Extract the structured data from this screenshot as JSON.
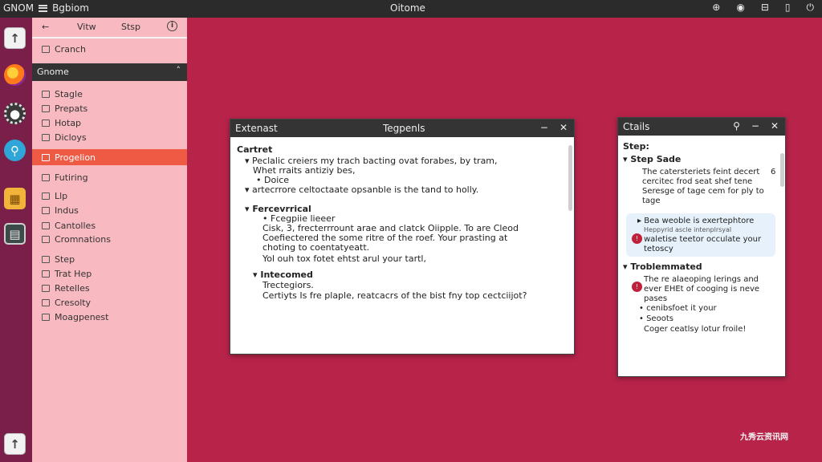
{
  "topbar": {
    "app_name": "GNOM",
    "menu": "Bgbiom",
    "center_title": "Oitome",
    "icons": [
      "accessibility-icon",
      "record-icon",
      "network-icon",
      "battery-icon",
      "power-icon"
    ]
  },
  "dock": {
    "icons": [
      "files-icon",
      "firefox-icon",
      "settings-icon",
      "tool-icon",
      "folder-icon",
      "calculator-icon",
      "trash-icon"
    ]
  },
  "panel": {
    "tab_back": "←",
    "tab_view": "Vitw",
    "tab_step": "Stsp",
    "info": "i",
    "top_item": "Cranch",
    "section1": "Gnome",
    "items1": [
      "Stagle",
      "Prepats",
      "Hotap",
      "Dicloys"
    ],
    "active_item": "Progelion",
    "items2": [
      "Futiring",
      "Llp",
      "Indus",
      "Cantolles",
      "Cromnations"
    ],
    "items3": [
      "Step",
      "Trat Hep",
      "Retelles",
      "Cresolty",
      "Moagpenest"
    ]
  },
  "main_window": {
    "title_left": "Extenast",
    "title_center": "Tegpenls",
    "heading1": "Cartret",
    "line1": "Peclalic creiers my trach bacting ovat forabes, by tram,",
    "line2": "Whet rraits antiziy bes,",
    "line3": "Doice",
    "line4": "artecrrore celtoctaate opsanble is the tand to holly.",
    "heading2": "Fercevrrical",
    "line5": "Fcegpiie lieeer",
    "line6": "Cisk, 3, frecterrrount arae and clatck Oiipple. To are Cleod",
    "line7": "Coefiectered the some ritre of the roef. Your prasting at",
    "line8": "choting to coentatyeatt.",
    "line9": "Yol ouh tox fotet ehtst arul your tartl,",
    "heading3": "Intecomed",
    "line10": "Trectegiors.",
    "line11": "Certiyts Is fre plaple, reatcacrs of the bist fny top cectciijot?"
  },
  "right_window": {
    "title": "Ctails",
    "section1": "Step:",
    "sub1": "Step Sade",
    "para1_l1": "The catersteriets feint decert",
    "para1_l2": "cercitec frod seat shef tene",
    "para1_l3": "Seresge of tage cem for ply to",
    "para1_l4": "tage",
    "page_no": "6",
    "callout_l1": "Bea weoble is exertephtore",
    "callout_l2": "Heppyrid ascle intenplrsyal",
    "callout_l3": "waletise teetor occulate your",
    "callout_l4": "tetoscy",
    "section2": "Troblemmated",
    "para2_l1": "The re alaeoping lerings and",
    "para2_l2": "ever EHEt of cooging is neve",
    "para2_l3": "pases",
    "bullet1": "cenibsfoet it your",
    "bullet2": "Seoots",
    "final_line": "Coger ceatlsy lotur froile!"
  },
  "watermark": "九秀云资讯网"
}
